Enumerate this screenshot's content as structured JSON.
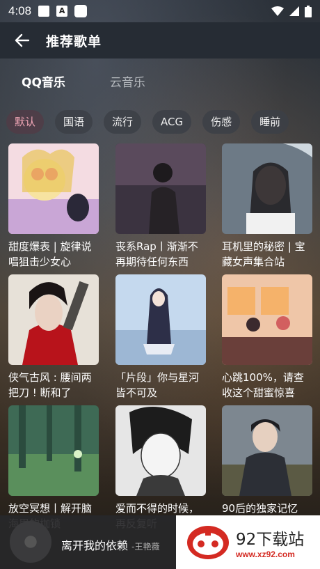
{
  "status": {
    "time": "4:08"
  },
  "header": {
    "title": "推荐歌单"
  },
  "tabs": [
    {
      "label": "QQ音乐",
      "active": true
    },
    {
      "label": "云音乐",
      "active": false
    }
  ],
  "chips": [
    {
      "label": "默认",
      "active": true
    },
    {
      "label": "国语",
      "active": false
    },
    {
      "label": "流行",
      "active": false
    },
    {
      "label": "ACG",
      "active": false
    },
    {
      "label": "伤感",
      "active": false
    },
    {
      "label": "睡前",
      "active": false
    }
  ],
  "playlists": [
    {
      "title": "甜度爆表 | 旋律说唱狙击少女心"
    },
    {
      "title": "丧系Rap丨渐渐不再期待任何东西"
    },
    {
      "title": "耳机里的秘密 | 宝藏女声集合站"
    },
    {
      "title": "侠气古风 : 腰间两把刀 ! 断和了"
    },
    {
      "title": "「片段」你与星河皆不可及"
    },
    {
      "title": "心跳100%，请查收这个甜蜜惊喜"
    },
    {
      "title": "放空冥想丨解开脑海里的枷锁"
    },
    {
      "title": "爱而不得的时候，再反复听"
    },
    {
      "title": "90后的独家记忆"
    }
  ],
  "player": {
    "song": "离开我的依赖",
    "artist": "-王艳薇"
  },
  "watermark": {
    "brand": "92下载站",
    "url": "www.xz92.com"
  },
  "colors": {
    "header_bg": "#262c34",
    "chip_active_text": "#f2a7b7",
    "watermark_red": "#d42a22"
  }
}
